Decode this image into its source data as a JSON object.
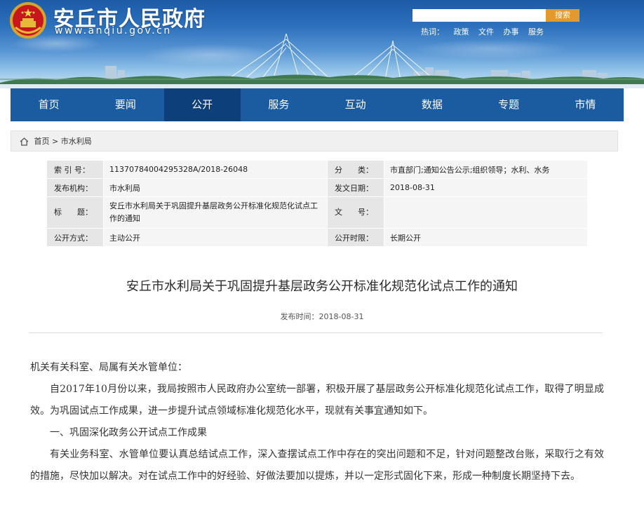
{
  "header": {
    "site_title": "安丘市人民政府",
    "site_url": "www.anqiu.gov.cn",
    "search": {
      "placeholder": "",
      "button_label": "搜索"
    },
    "hotwords_label": "热词：",
    "hotwords": [
      "政策",
      "文件",
      "办事",
      "服务"
    ]
  },
  "nav": {
    "items": [
      {
        "label": "首页"
      },
      {
        "label": "要闻"
      },
      {
        "label": "公开"
      },
      {
        "label": "服务"
      },
      {
        "label": "互动"
      },
      {
        "label": "数据"
      },
      {
        "label": "专题"
      },
      {
        "label": "市情"
      }
    ],
    "active_label": "公开"
  },
  "breadcrumb": {
    "home": "首页",
    "separator": ">",
    "current": "市水利局"
  },
  "meta": {
    "index_label": "索 引 号：",
    "index_value": "11370784004295328A/2018-26048",
    "category_label": "分　　类：",
    "category_value": "市直部门;通知公告公示;组织领导；水利、水务",
    "publisher_label": "发布机构：",
    "publisher_value": "市水利局",
    "date_label": "发文日期：",
    "date_value": "2018-08-31",
    "title_label": "标　　题：",
    "title_value": "安丘市水利局关于巩固提升基层政务公开标准化规范化试点工作的通知",
    "docno_label": "文　　号：",
    "docno_value": "",
    "method_label": "公开方式：",
    "method_value": "主动公开",
    "period_label": "公开时限：",
    "period_value": "长期公开"
  },
  "article": {
    "title": "安丘市水利局关于巩固提升基层政务公开标准化规范化试点工作的通知",
    "published": "发布时间：2018-08-31",
    "salutation": "机关有关科室、局属有关水管单位：",
    "para1": "自2017年10月份以来，我局按照市人民政府办公室统一部署，积极开展了基层政务公开标准化规范化试点工作，取得了明显成效。为巩固试点工作成果，进一步提升试点领域标准化规范化水平，现就有关事宜通知如下。",
    "heading1": "一、巩固深化政务公开试点工作成果",
    "para2": "有关业务科室、水管单位要认真总结试点工作，深入查摆试点工作中存在的突出问题和不足，针对问题整改台账，采取行之有效的措施，尽快加以解决。对在试点工作中的好经验、好做法要加以提炼，并以一定形式固化下来，形成一种制度长期坚持下去。"
  }
}
